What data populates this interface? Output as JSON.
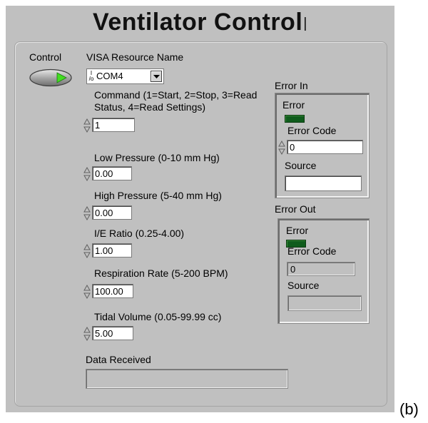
{
  "panel": {
    "title": "Ventilator Control",
    "title_cursor": "|"
  },
  "figure_label": "(b)",
  "control": {
    "label": "Control",
    "state": "on",
    "led_color": "#44dd22"
  },
  "visa": {
    "label": "VISA Resource Name",
    "io_glyph": "I/O",
    "value": "COM4"
  },
  "command": {
    "label": "Command (1=Start, 2=Stop, 3=Read Status, 4=Read Settings)",
    "value": "1"
  },
  "low_pressure": {
    "label": "Low Pressure (0-10 mm Hg)",
    "value": "0.00"
  },
  "high_pressure": {
    "label": "High Pressure (5-40 mm Hg)",
    "value": "0.00"
  },
  "ie_ratio": {
    "label": "I/E Ratio (0.25-4.00)",
    "value": "1.00"
  },
  "respiration_rate": {
    "label": "Respiration Rate (5-200 BPM)",
    "value": "100.00"
  },
  "tidal_volume": {
    "label": "Tidal Volume (0.05-99.99 cc)",
    "value": "5.00"
  },
  "data_received": {
    "label": "Data Received",
    "value": ""
  },
  "error_in": {
    "title": "Error In",
    "status_label": "Error",
    "code_label": "Error Code",
    "code_value": "0",
    "source_label": "Source",
    "source_value": ""
  },
  "error_out": {
    "title": "Error Out",
    "status_label": "Error",
    "code_label": "Error Code",
    "code_value": "0",
    "source_label": "Source",
    "source_value": ""
  }
}
